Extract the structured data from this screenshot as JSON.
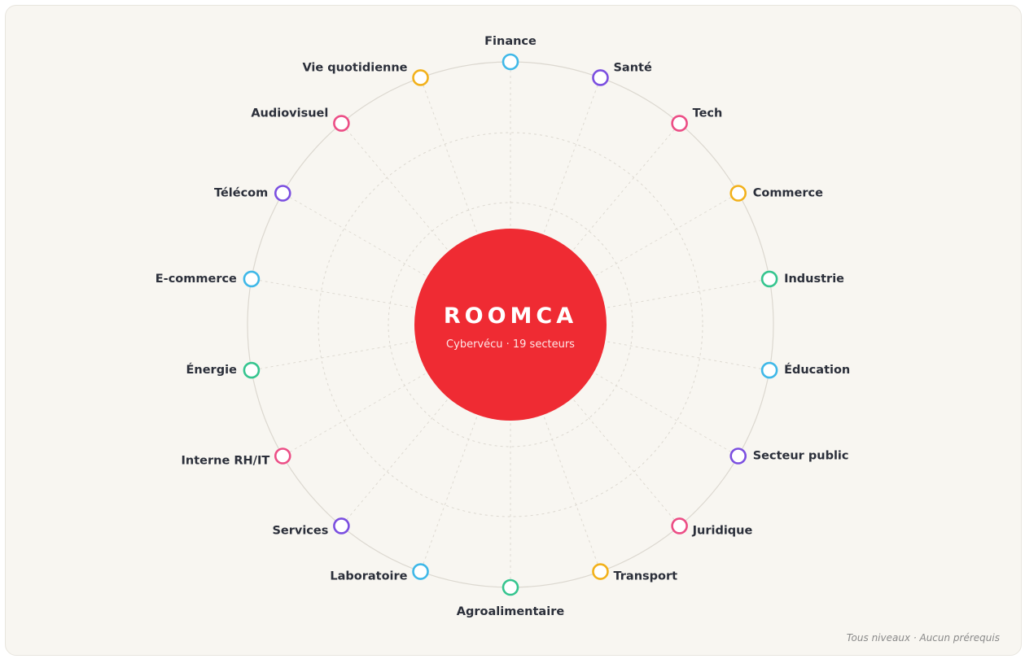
{
  "hub": {
    "title": "ROOMCA",
    "subtitle": "Cybervécu · 19 secteurs",
    "color": "#ef2b33"
  },
  "footer": {
    "note": "Tous niveaux · Aucun prérequis"
  },
  "colors": {
    "blue": "#3fb8e8",
    "purple": "#7b4fe0",
    "pink": "#ec4e86",
    "yellow": "#f2b11b",
    "green": "#35c58f",
    "ring": "#dcd8d0",
    "spoke": "#dedad2",
    "label": "#2b2f3a"
  },
  "sectors": [
    {
      "label": "Finance",
      "color": "blue"
    },
    {
      "label": "Santé",
      "color": "purple"
    },
    {
      "label": "Tech",
      "color": "pink"
    },
    {
      "label": "Commerce",
      "color": "yellow"
    },
    {
      "label": "Industrie",
      "color": "green"
    },
    {
      "label": "Éducation",
      "color": "blue"
    },
    {
      "label": "Secteur public",
      "color": "purple"
    },
    {
      "label": "Juridique",
      "color": "pink"
    },
    {
      "label": "Transport",
      "color": "yellow"
    },
    {
      "label": "Agroalimentaire",
      "color": "green"
    },
    {
      "label": "Laboratoire",
      "color": "blue"
    },
    {
      "label": "Services",
      "color": "purple"
    },
    {
      "label": "Interne RH/IT",
      "color": "pink"
    },
    {
      "label": "Énergie",
      "color": "green"
    },
    {
      "label": "E-commerce",
      "color": "blue"
    },
    {
      "label": "Télécom",
      "color": "purple"
    },
    {
      "label": "Audiovisuel",
      "color": "pink"
    },
    {
      "label": "Vie quotidienne",
      "color": "yellow"
    }
  ]
}
